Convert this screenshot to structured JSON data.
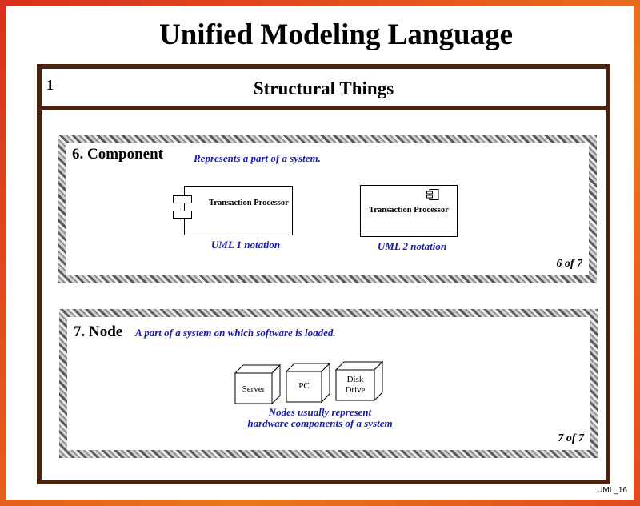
{
  "title": "Unified Modeling Language",
  "slide_number": "1",
  "section_title": "Structural Things",
  "component": {
    "heading": "6. Component",
    "description": "Represents a part of a system.",
    "uml1_box_label": "Transaction Processor",
    "uml1_caption": "UML 1 notation",
    "uml2_box_label": "Transaction Processor",
    "uml2_caption": "UML 2 notation",
    "pager": "6 of 7"
  },
  "node": {
    "heading": "7. Node",
    "description": "A part of a system on which software is loaded.",
    "items": [
      "Server",
      "PC",
      "Disk Drive"
    ],
    "caption_line1": "Nodes usually represent",
    "caption_line2": "hardware components of a system",
    "pager": "7 of 7"
  },
  "footer": "UML_16",
  "colors": {
    "frame": "#4a2410",
    "caption_text": "#1a1aa6",
    "background_gradient": [
      "#d8301f",
      "#e9771b"
    ]
  }
}
